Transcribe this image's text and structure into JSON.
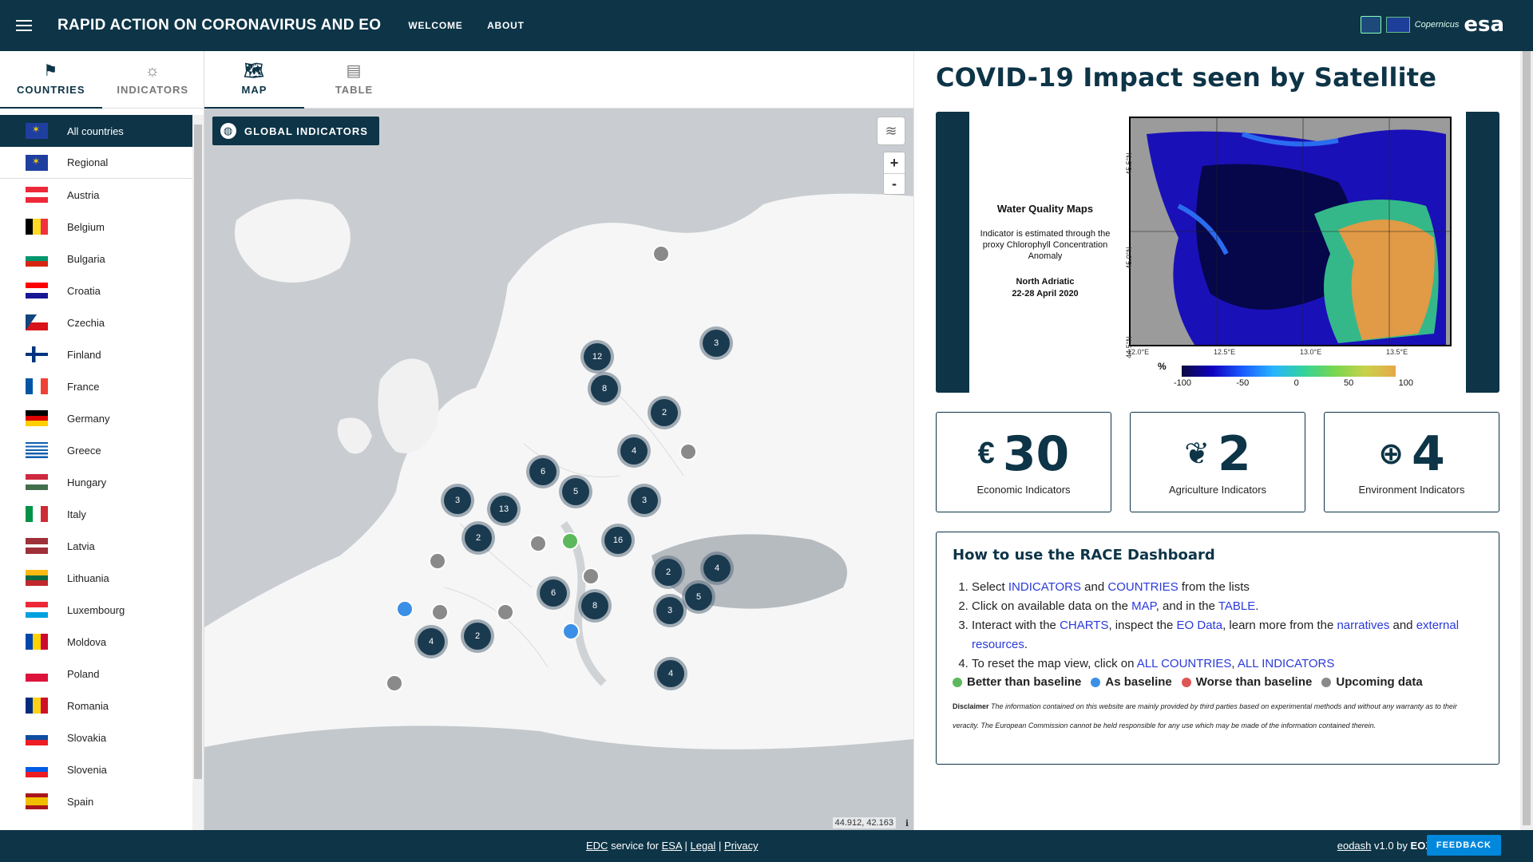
{
  "header": {
    "title": "RAPID ACTION ON CORONAVIRUS AND EO",
    "nav": [
      "WELCOME",
      "ABOUT"
    ],
    "logo_copernicus": "Copernicus",
    "logo_esa": "esa"
  },
  "left_tabs": {
    "countries": "COUNTRIES",
    "indicators": "INDICATORS"
  },
  "countries": [
    "All countries",
    "Regional",
    "Austria",
    "Belgium",
    "Bulgaria",
    "Croatia",
    "Czechia",
    "Finland",
    "France",
    "Germany",
    "Greece",
    "Hungary",
    "Italy",
    "Latvia",
    "Lithuania",
    "Luxembourg",
    "Moldova",
    "Poland",
    "Romania",
    "Slovakia",
    "Slovenia",
    "Spain"
  ],
  "mid_tabs": {
    "map": "MAP",
    "table": "TABLE"
  },
  "map": {
    "global_indicators": "GLOBAL INDICATORS",
    "zoom_in": "+",
    "zoom_out": "-",
    "coords": "44.912, 42.163",
    "info": "ℹ",
    "clusters": [
      "12",
      "8",
      "3",
      "2",
      "4",
      "6",
      "5",
      "3",
      "3",
      "13",
      "2",
      "16",
      "2",
      "4",
      "5",
      "3",
      "6",
      "8",
      "2",
      "4",
      "4"
    ]
  },
  "right": {
    "title": "COVID-19 Impact seen by Satellite",
    "feature": {
      "title": "Water Quality Maps",
      "desc": "Indicator is estimated through the proxy Chlorophyll Concentration Anomaly",
      "region": "North Adriatic",
      "dates": "22-28 April 2020",
      "pct": "%",
      "scale": [
        "-100",
        "-50",
        "0",
        "50",
        "100"
      ],
      "lat1": "45.5°N",
      "lat2": "45.0°N",
      "lat3": "44.5°N",
      "lon": [
        "12.0°E",
        "12.5°E",
        "13.0°E",
        "13.5°E"
      ]
    },
    "cards": [
      {
        "icon": "€",
        "value": "30",
        "label": "Economic Indicators"
      },
      {
        "icon": "❦",
        "value": "2",
        "label": "Agriculture Indicators"
      },
      {
        "icon": "⊕",
        "value": "4",
        "label": "Environment Indicators"
      }
    ],
    "howto": {
      "title": "How to use the RACE Dashboard",
      "s1_pre": "Select ",
      "s1_l1": "INDICATORS",
      "s1_mid": " and ",
      "s1_l2": "COUNTRIES",
      "s1_post": " from the lists",
      "s2_pre": "Click on available data on the ",
      "s2_l1": "MAP",
      "s2_mid": ", and in the ",
      "s2_l2": "TABLE",
      "s2_post": ".",
      "s3_pre": "Interact with the ",
      "s3_l1": "CHARTS",
      "s3_mid1": ", inspect the ",
      "s3_l2": "EO Data",
      "s3_mid2": ", learn more from the ",
      "s3_l3": "narratives",
      "s3_mid3": " and ",
      "s3_l4": "external resources",
      "s3_post": ".",
      "s4_pre": "To reset the map view, click on ",
      "s4_l1": "ALL COUNTRIES",
      "s4_mid": ", ",
      "s4_l2": "ALL INDICATORS",
      "legend": [
        {
          "label": "Better than baseline",
          "color": "#5cb85c"
        },
        {
          "label": "As baseline",
          "color": "#3c8fe6"
        },
        {
          "label": "Worse than baseline",
          "color": "#e05555"
        },
        {
          "label": "Upcoming data",
          "color": "#8a8a8a"
        }
      ],
      "disclaimer_label": "Disclaimer",
      "disclaimer": "The information contained on this website are mainly provided by third parties based on experimental methods and without any warranty as to their veracity. The European Commission cannot be held responsible for any use which may be made of the information contained therein."
    }
  },
  "footer": {
    "edc": "EDC",
    "service_for": " service for ",
    "esa": "ESA",
    "sep1": " | ",
    "legal": "Legal",
    "sep2": " | ",
    "privacy": "Privacy",
    "eodash": "eodash",
    "version": " v1.0 by ",
    "eox": "EOX",
    "feedback": "FEEDBACK"
  }
}
